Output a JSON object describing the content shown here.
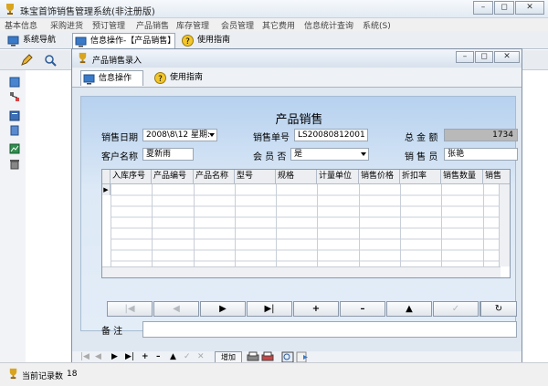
{
  "app": {
    "title": "珠宝首饰销售管理系统(非注册版)"
  },
  "window_controls": {
    "minimize": "–",
    "maximize": "◻",
    "close": "✕"
  },
  "menu": [
    "基本信息",
    "采购进货",
    "预订管理",
    "产品销售",
    "库存管理",
    "会员管理",
    "其它费用",
    "信息统计查询",
    "系统(S)"
  ],
  "main_tabs": [
    {
      "label": "系统导航"
    },
    {
      "label": "信息操作-【产品销售】"
    },
    {
      "label": "使用指南"
    }
  ],
  "status": {
    "records_label": "当前记录数",
    "records_count": "18"
  },
  "sales_window": {
    "title": "产品销售录入",
    "tabs": [
      {
        "label": "信息操作"
      },
      {
        "label": "使用指南"
      }
    ],
    "heading": "产品销售",
    "fields": {
      "date_label": "销售日期",
      "date_value": "2008\\8\\12 星期:",
      "order_label": "销售单号",
      "order_value": "LS20080812001",
      "total_label": "总 金 额",
      "total_value": "1734",
      "customer_label": "客户名称",
      "customer_value": "夏新雨",
      "member_label": "会 员 否",
      "member_value": "是",
      "salesperson_label": "销 售 员",
      "salesperson_value": "张艳"
    },
    "grid_columns": [
      "入库序号",
      "产品编号",
      "产品名称",
      "型号",
      "规格",
      "计量单位",
      "销售价格",
      "折扣率",
      "销售数量",
      "销售"
    ],
    "nav_buttons": [
      "|◀",
      "◀",
      "▶",
      "▶|",
      "+",
      "–",
      "▲",
      "✓",
      "✕",
      "↻"
    ],
    "remark_label": "备    注",
    "bottom_toolbar": {
      "add_label": "增加",
      "nav_symbols": [
        "|◀",
        "◀",
        "▶",
        "▶|",
        "+",
        "–",
        "▲",
        "✓",
        "✕"
      ]
    }
  },
  "colors": {
    "accent": "#b6d1ef",
    "title": "#dfe7f1"
  }
}
